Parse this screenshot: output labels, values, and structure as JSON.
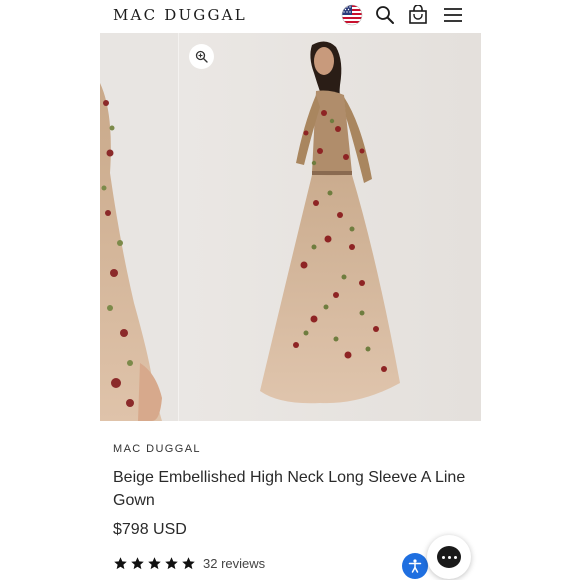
{
  "header": {
    "logo": "MAC DUGGAL",
    "icons": [
      "us-flag-icon",
      "search-icon",
      "shopping-bag-icon",
      "hamburger-menu-icon"
    ]
  },
  "gallery": {
    "images": [
      "gown-side-view",
      "gown-back-view"
    ],
    "zoom_icon": "zoom-in-icon"
  },
  "product": {
    "brand": "MAC DUGGAL",
    "title": "Beige Embellished High Neck Long Sleeve A Line Gown",
    "price": "$798 USD",
    "rating": 5,
    "reviews_label": "32 reviews"
  },
  "widgets": {
    "accessibility_icon": "accessibility-icon",
    "chat_icon": "chat-bubble-icon"
  },
  "colors": {
    "accessibility": "#1f6fe0",
    "text": "#2a2a2a",
    "gown_tulle": "#d8b99c"
  }
}
